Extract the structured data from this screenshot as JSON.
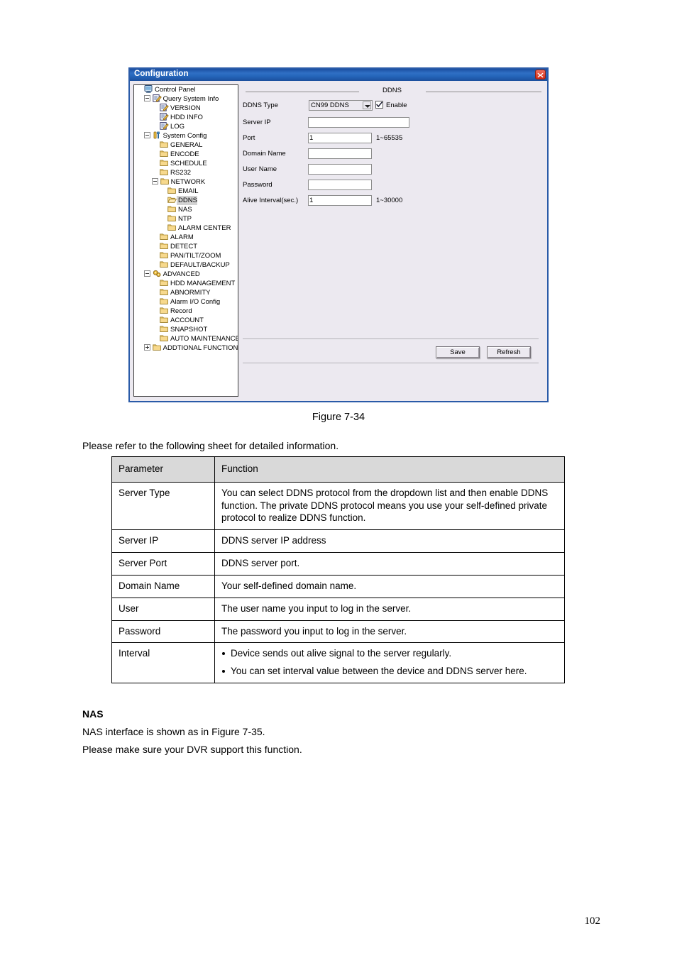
{
  "dialog": {
    "title": "Configuration",
    "close_icon": "close-icon",
    "section_title": "DDNS",
    "tree": [
      {
        "label": "Control Panel",
        "depth": 0,
        "icon": "monitor-icon",
        "expander": "none",
        "selected": false
      },
      {
        "label": "Query System Info",
        "depth": 1,
        "icon": "note-pencil-icon",
        "expander": "minus",
        "selected": false
      },
      {
        "label": "VERSION",
        "depth": 2,
        "icon": "note-pencil-icon",
        "expander": "none",
        "selected": false
      },
      {
        "label": "HDD INFO",
        "depth": 2,
        "icon": "note-pencil-icon",
        "expander": "none",
        "selected": false
      },
      {
        "label": "LOG",
        "depth": 2,
        "icon": "note-pencil-icon",
        "expander": "none",
        "selected": false
      },
      {
        "label": "System Config",
        "depth": 1,
        "icon": "tools-icon",
        "expander": "minus",
        "selected": false
      },
      {
        "label": "GENERAL",
        "depth": 2,
        "icon": "folder-icon",
        "expander": "none",
        "selected": false
      },
      {
        "label": "ENCODE",
        "depth": 2,
        "icon": "folder-icon",
        "expander": "none",
        "selected": false
      },
      {
        "label": "SCHEDULE",
        "depth": 2,
        "icon": "folder-icon",
        "expander": "none",
        "selected": false
      },
      {
        "label": "RS232",
        "depth": 2,
        "icon": "folder-icon",
        "expander": "none",
        "selected": false
      },
      {
        "label": "NETWORK",
        "depth": 2,
        "icon": "folder-icon",
        "expander": "minus",
        "selected": false
      },
      {
        "label": "EMAIL",
        "depth": 3,
        "icon": "folder-icon",
        "expander": "none",
        "selected": false
      },
      {
        "label": "DDNS",
        "depth": 3,
        "icon": "folder-open-icon",
        "expander": "none",
        "selected": true
      },
      {
        "label": "NAS",
        "depth": 3,
        "icon": "folder-icon",
        "expander": "none",
        "selected": false
      },
      {
        "label": "NTP",
        "depth": 3,
        "icon": "folder-icon",
        "expander": "none",
        "selected": false
      },
      {
        "label": "ALARM CENTER",
        "depth": 3,
        "icon": "folder-icon",
        "expander": "none",
        "selected": false
      },
      {
        "label": "ALARM",
        "depth": 2,
        "icon": "folder-icon",
        "expander": "none",
        "selected": false
      },
      {
        "label": "DETECT",
        "depth": 2,
        "icon": "folder-icon",
        "expander": "none",
        "selected": false
      },
      {
        "label": "PAN/TILT/ZOOM",
        "depth": 2,
        "icon": "folder-icon",
        "expander": "none",
        "selected": false
      },
      {
        "label": "DEFAULT/BACKUP",
        "depth": 2,
        "icon": "folder-icon",
        "expander": "none",
        "selected": false
      },
      {
        "label": "ADVANCED",
        "depth": 1,
        "icon": "gears-icon",
        "expander": "minus",
        "selected": false
      },
      {
        "label": "HDD MANAGEMENT",
        "depth": 2,
        "icon": "folder-icon",
        "expander": "none",
        "selected": false
      },
      {
        "label": "ABNORMITY",
        "depth": 2,
        "icon": "folder-icon",
        "expander": "none",
        "selected": false
      },
      {
        "label": "Alarm I/O Config",
        "depth": 2,
        "icon": "folder-icon",
        "expander": "none",
        "selected": false
      },
      {
        "label": "Record",
        "depth": 2,
        "icon": "folder-icon",
        "expander": "none",
        "selected": false
      },
      {
        "label": "ACCOUNT",
        "depth": 2,
        "icon": "folder-icon",
        "expander": "none",
        "selected": false
      },
      {
        "label": "SNAPSHOT",
        "depth": 2,
        "icon": "folder-icon",
        "expander": "none",
        "selected": false
      },
      {
        "label": "AUTO MAINTENANCE",
        "depth": 2,
        "icon": "folder-icon",
        "expander": "none",
        "selected": false
      },
      {
        "label": "ADDTIONAL FUNCTION",
        "depth": 1,
        "icon": "folder-icon",
        "expander": "plus",
        "selected": false
      }
    ],
    "form": {
      "ddns_type_label": "DDNS Type",
      "ddns_type_value": "CN99 DDNS",
      "enable_label": "Enable",
      "enable_checked": true,
      "server_ip_label": "Server IP",
      "server_ip_value": "",
      "port_label": "Port",
      "port_value": "1",
      "port_hint": "1~65535",
      "domain_name_label": "Domain Name",
      "domain_name_value": "",
      "user_name_label": "User Name",
      "user_name_value": "",
      "password_label": "Password",
      "password_value": "",
      "alive_interval_label": "Alive Interval(sec.)",
      "alive_interval_value": "1",
      "alive_interval_hint": "1~30000"
    },
    "buttons": {
      "save": "Save",
      "refresh": "Refresh"
    }
  },
  "document": {
    "figure_caption": "Figure 7-34",
    "intro": "Please refer to the following sheet for detailed information.",
    "table": {
      "headers": [
        "Parameter",
        "Function"
      ],
      "rows": [
        {
          "param": "Server Type",
          "func": "You can select DDNS protocol from the dropdown list and then enable DDNS function. The private DDNS protocol means you use your self-defined private protocol to realize DDNS function."
        },
        {
          "param": "Server IP",
          "func": "DDNS server IP address"
        },
        {
          "param": "Server Port",
          "func": "DDNS server port."
        },
        {
          "param": "Domain Name",
          "func": "Your self-defined domain name."
        },
        {
          "param": "User",
          "func": "The user name you input to log in the server."
        },
        {
          "param": "Password",
          "func": "The password you input to log in the server."
        },
        {
          "param": "Interval",
          "bullets": [
            "Device sends out alive signal to the server regularly.",
            "You can set interval value between the device and DDNS server here."
          ]
        }
      ]
    },
    "nas_heading": "NAS",
    "nas_line1": "NAS interface is shown as in Figure 7-35.",
    "nas_line2": "Please make sure your DVR support this function.",
    "page_number": "102"
  }
}
